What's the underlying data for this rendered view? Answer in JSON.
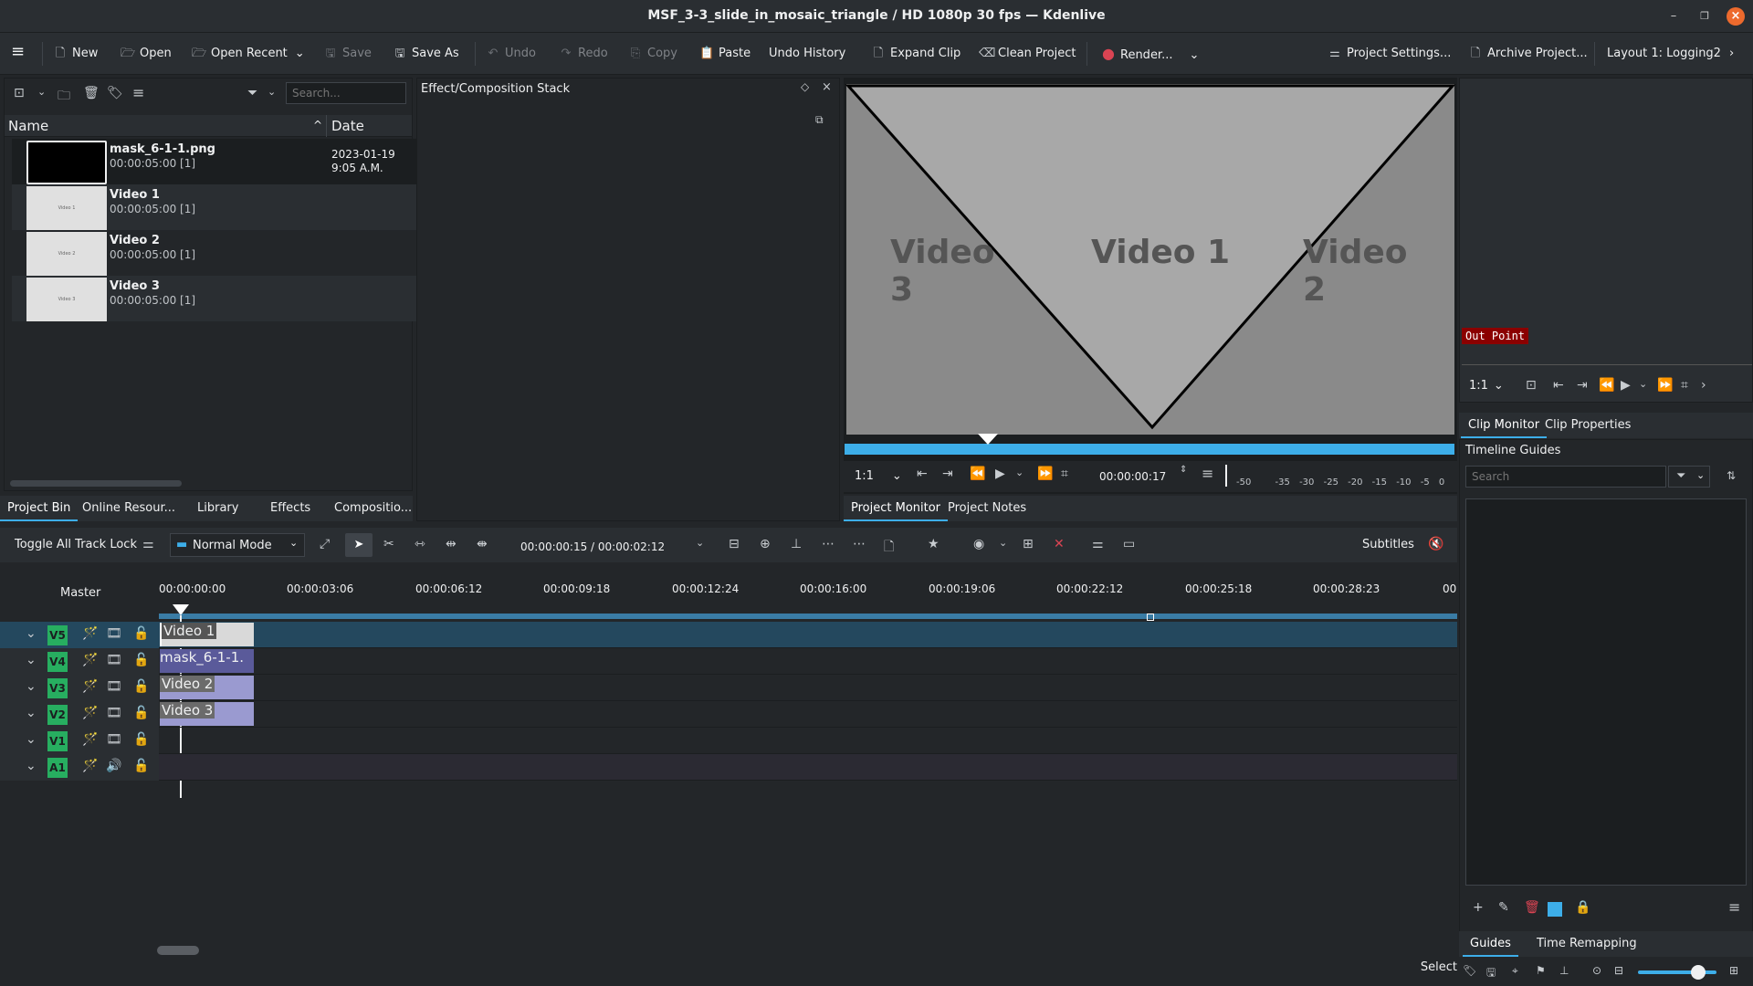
{
  "window": {
    "title": "MSF_3-3_slide_in_mosaic_triangle / HD 1080p 30 fps — Kdenlive"
  },
  "toolbar": {
    "new": "New",
    "open": "Open",
    "open_recent": "Open Recent",
    "save": "Save",
    "save_as": "Save As",
    "undo": "Undo",
    "redo": "Redo",
    "copy": "Copy",
    "paste": "Paste",
    "undo_history": "Undo History",
    "expand_clip": "Expand Clip",
    "clean_project": "Clean Project",
    "render": "Render...",
    "project_settings": "Project Settings...",
    "archive_project": "Archive Project...",
    "layout": "Layout 1: Logging2"
  },
  "bin": {
    "search_placeholder": "Search...",
    "col_name": "Name",
    "col_date": "Date",
    "items": [
      {
        "name": "mask_6-1-1.png",
        "duration": "00:00:05:00 [1]",
        "date": "2023-01-19",
        "time": "9:05 A.M."
      },
      {
        "name": "Video 1",
        "duration": "00:00:05:00 [1]"
      },
      {
        "name": "Video 2",
        "duration": "00:00:05:00 [1]"
      },
      {
        "name": "Video 3",
        "duration": "00:00:05:00 [1]"
      }
    ],
    "tabs": [
      "Project Bin",
      "Online Resour...",
      "Library",
      "Effects",
      "Compositio..."
    ]
  },
  "effect_stack": {
    "title": "Effect/Composition Stack"
  },
  "project_monitor": {
    "labels": [
      "Video 3",
      "Video 1",
      "Video 2"
    ],
    "zoom": "1:1",
    "timecode": "00:00:00:17",
    "meter_labels": [
      "-50",
      "-35",
      "-30",
      "-25",
      "-20",
      "-15",
      "-10",
      "-5",
      "0"
    ],
    "tabs": [
      "Project Monitor",
      "Project Notes"
    ]
  },
  "clip_monitor": {
    "out_point": "Out Point",
    "zoom": "1:1",
    "tabs": [
      "Clip Monitor",
      "Clip Properties"
    ]
  },
  "guides": {
    "title": "Timeline Guides",
    "search_placeholder": "Search",
    "tabs": [
      "Guides",
      "Time Remapping"
    ]
  },
  "timeline": {
    "toggle_lock": "Toggle All Track Lock",
    "mode": "Normal Mode",
    "position": "00:00:00:15 / 00:00:02:12",
    "subtitles": "Subtitles",
    "master": "Master",
    "ruler": [
      "00:00:00:00",
      "00:00:03:06",
      "00:00:06:12",
      "00:00:09:18",
      "00:00:12:24",
      "00:00:16:00",
      "00:00:19:06",
      "00:00:22:12",
      "00:00:25:18",
      "00:00:28:23",
      "00"
    ],
    "tracks": [
      {
        "name": "V5",
        "clip": "Video 1"
      },
      {
        "name": "V4",
        "clip": "mask_6-1-1."
      },
      {
        "name": "V3",
        "clip": "Video 2"
      },
      {
        "name": "V2",
        "clip": "Video 3"
      },
      {
        "name": "V1",
        "clip": ""
      },
      {
        "name": "A1",
        "clip": ""
      }
    ]
  },
  "statusbar": {
    "select": "Select"
  },
  "colors": {
    "accent": "#3daee9",
    "track_green": "#27ae60",
    "out_point_bg": "#8b0000"
  }
}
